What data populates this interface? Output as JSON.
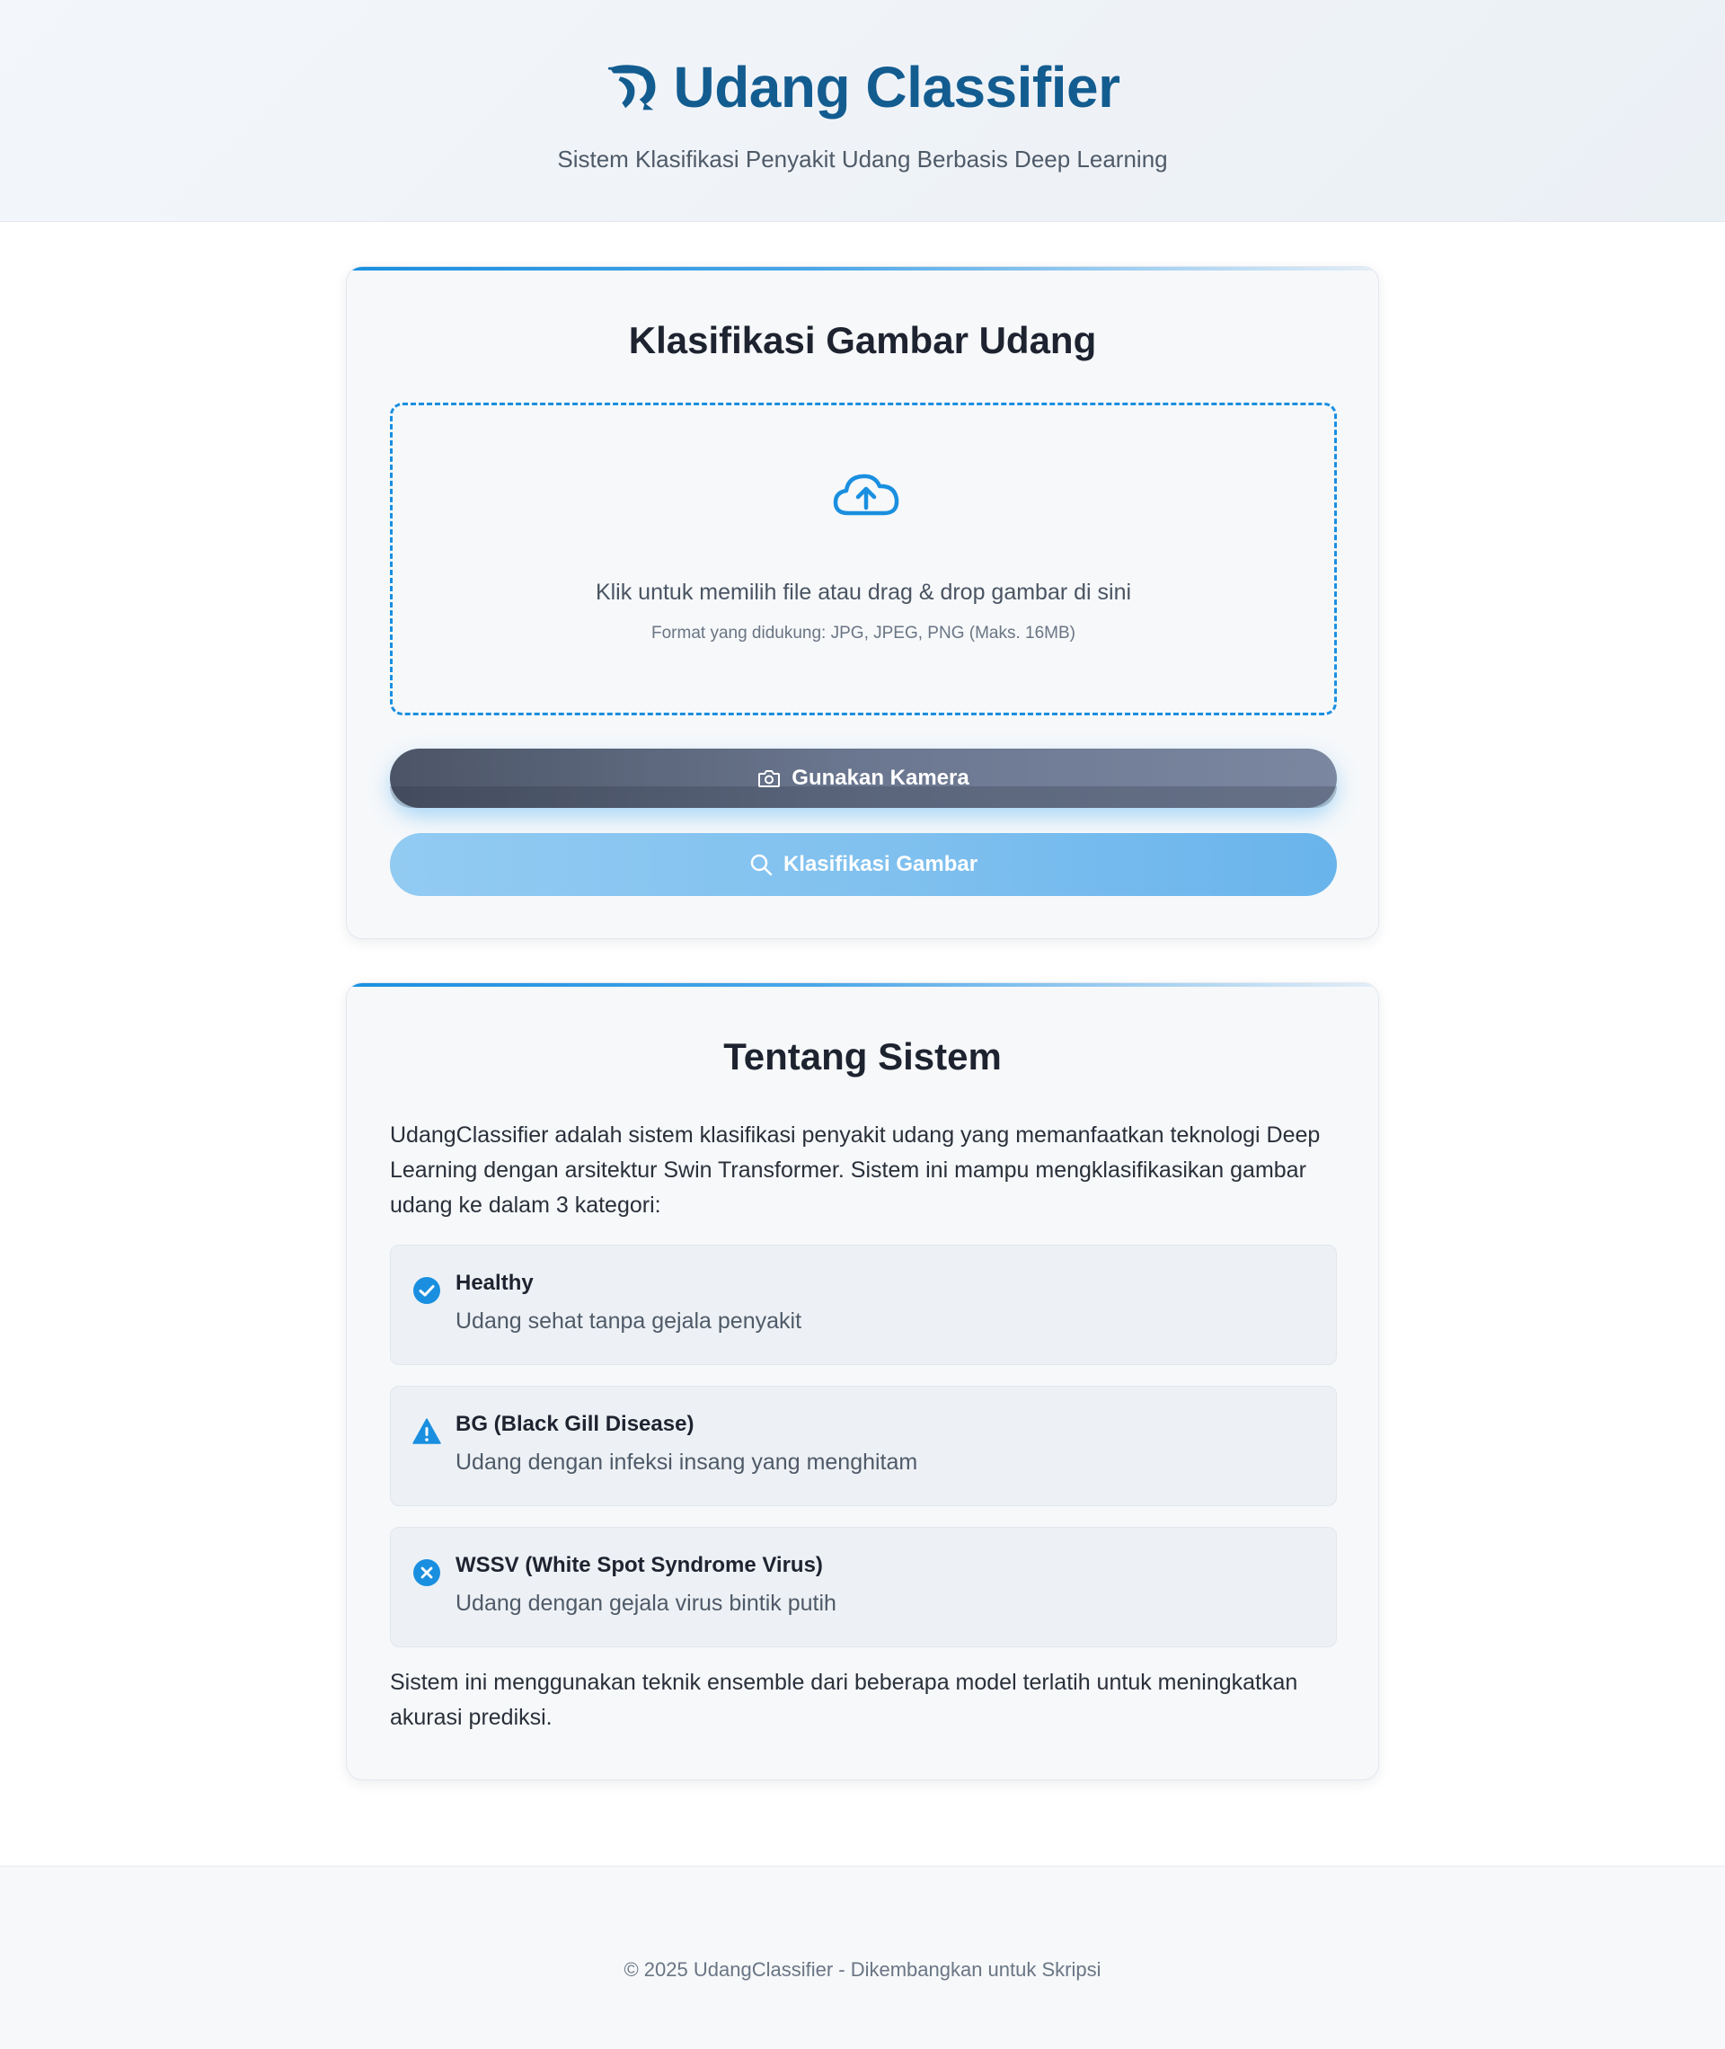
{
  "header": {
    "title": "Udang Classifier",
    "subtitle": "Sistem Klasifikasi Penyakit Udang Berbasis Deep Learning",
    "logo_icon": "shrimp-icon"
  },
  "upload_card": {
    "title": "Klasifikasi Gambar Udang",
    "dropzone": {
      "icon": "cloud-upload-icon",
      "main_text": "Klik untuk memilih file atau drag & drop gambar di sini",
      "hint_text": "Format yang didukung: JPG, JPEG, PNG (Maks. 16MB)"
    },
    "camera_button": {
      "label": "Gunakan Kamera",
      "icon": "camera-icon"
    },
    "classify_button": {
      "label": "Klasifikasi Gambar",
      "icon": "search-icon"
    }
  },
  "about_card": {
    "title": "Tentang Sistem",
    "intro": "UdangClassifier adalah sistem klasifikasi penyakit udang yang memanfaatkan teknologi Deep Learning dengan arsitektur Swin Transformer. Sistem ini mampu mengklasifikasikan gambar udang ke dalam 3 kategori:",
    "categories": [
      {
        "name": "Healthy",
        "description": "Udang sehat tanpa gejala penyakit",
        "icon": "check-circle-icon"
      },
      {
        "name": "BG (Black Gill Disease)",
        "description": "Udang dengan infeksi insang yang menghitam",
        "icon": "warning-triangle-icon"
      },
      {
        "name": "WSSV (White Spot Syndrome Virus)",
        "description": "Udang dengan gejala virus bintik putih",
        "icon": "x-circle-icon"
      }
    ],
    "closing": "Sistem ini menggunakan teknik ensemble dari beberapa model terlatih untuk meningkatkan akurasi prediksi."
  },
  "footer": {
    "copyright": "© 2025 UdangClassifier - Dikembangkan untuk Skripsi"
  },
  "colors": {
    "brand": "#135c90",
    "accent": "#1a8fe0",
    "camera_button": "#5e6a80",
    "classify_button": "#81c1ef"
  }
}
